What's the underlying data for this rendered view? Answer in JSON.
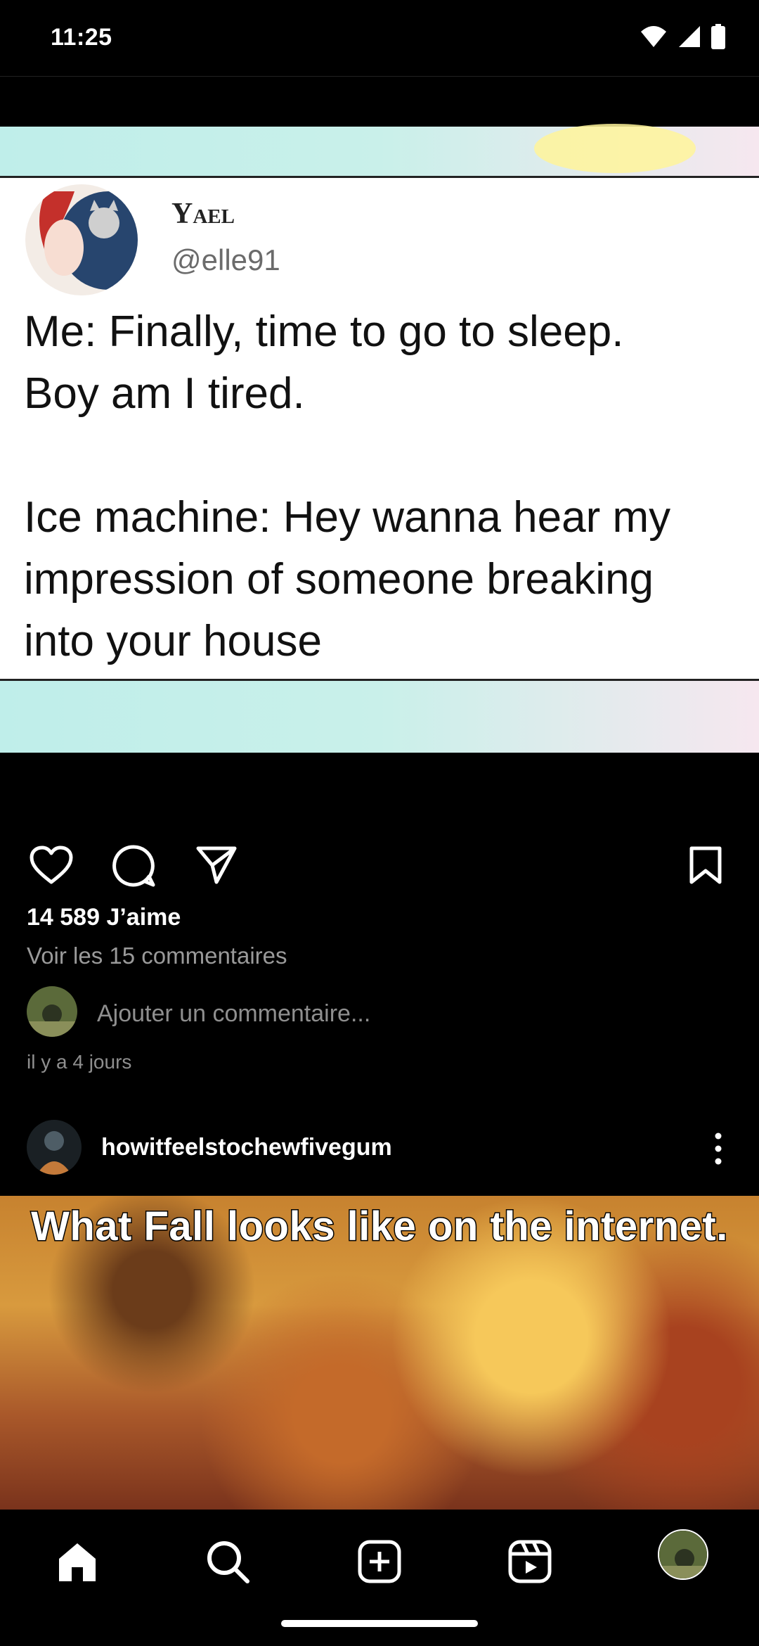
{
  "status_bar": {
    "time": "11:25",
    "icons": [
      "wifi-icon",
      "cell-signal-icon",
      "battery-icon"
    ]
  },
  "post1": {
    "tweet": {
      "name": "Yael",
      "handle": "@elle91",
      "line1": "Me: Finally, time to go to sleep.",
      "line2": "Boy am I tired.",
      "line3": "Ice machine: Hey wanna hear my",
      "line4": "impression of someone breaking",
      "line5": "into your house"
    },
    "likes": "14 589 J’aime",
    "view_comments": "Voir les 15 commentaires",
    "add_comment_placeholder": "Ajouter un commentaire...",
    "time_ago": "il y a 4 jours"
  },
  "post2": {
    "username": "howitfeelstochewfivegum",
    "caption": "What Fall looks like on the internet."
  },
  "bottom_nav": [
    "home-icon",
    "search-icon",
    "add-post-icon",
    "reels-icon",
    "profile-avatar"
  ]
}
